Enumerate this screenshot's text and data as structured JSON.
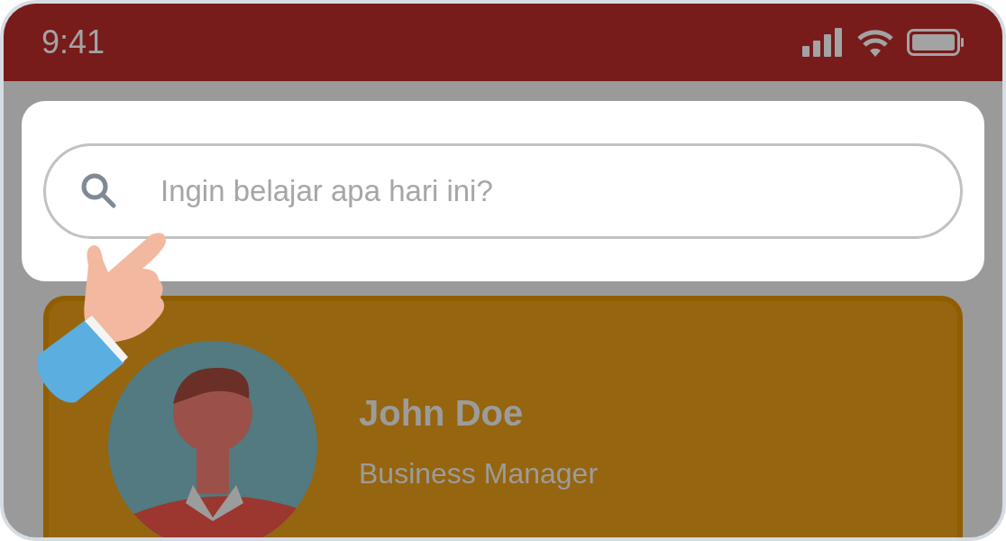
{
  "status_bar": {
    "time": "9:41"
  },
  "search": {
    "placeholder": "Ingin belajar apa hari ini?"
  },
  "profile": {
    "name": "John Doe",
    "role": "Business Manager"
  }
}
